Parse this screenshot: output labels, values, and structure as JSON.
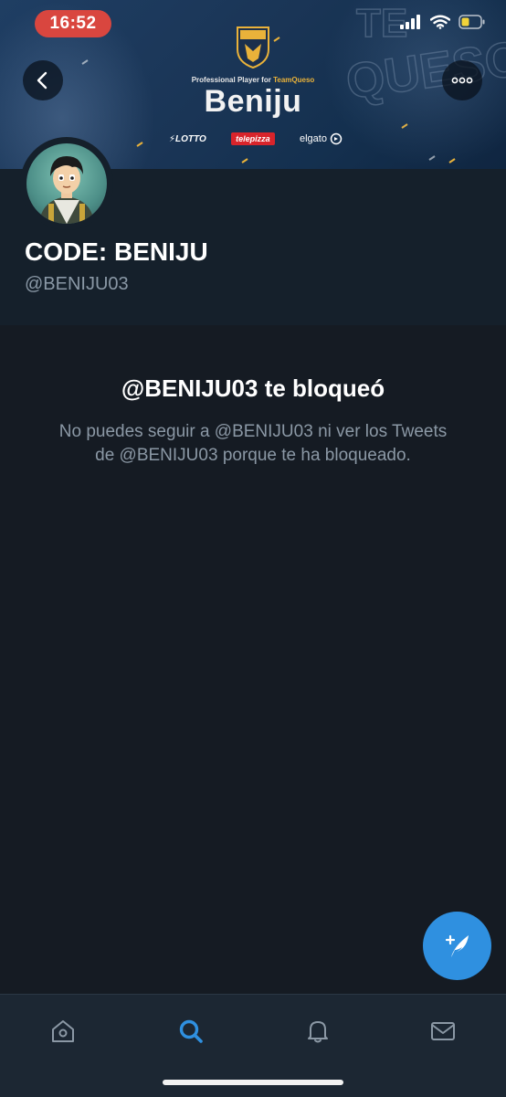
{
  "status_bar": {
    "time": "16:52"
  },
  "banner": {
    "logo_text": "QUESO",
    "tagline_prefix": "Professional Player for",
    "tagline_team": "TeamQueso",
    "player_name": "Beniju",
    "sponsors": [
      "LOTTO",
      "telepizza",
      "elgato"
    ],
    "background_word": "TEAM QUESO"
  },
  "profile": {
    "display_name": "CODE: BENIJU",
    "handle": "@BENIJU03"
  },
  "blocked": {
    "title": "@BENIJU03 te bloqueó",
    "message": "No puedes seguir a @BENIJU03 ni ver los Tweets de @BENIJU03 porque te ha bloqueado."
  },
  "tabs": [
    {
      "name": "home",
      "icon": "home-icon",
      "active": false
    },
    {
      "name": "search",
      "icon": "search-icon",
      "active": true
    },
    {
      "name": "notifications",
      "icon": "bell-icon",
      "active": false
    },
    {
      "name": "messages",
      "icon": "mail-icon",
      "active": false
    }
  ],
  "colors": {
    "accent": "#2f90e0",
    "background": "#15202b",
    "muted_text": "#8b98a5",
    "time_pill": "#d9463f"
  }
}
